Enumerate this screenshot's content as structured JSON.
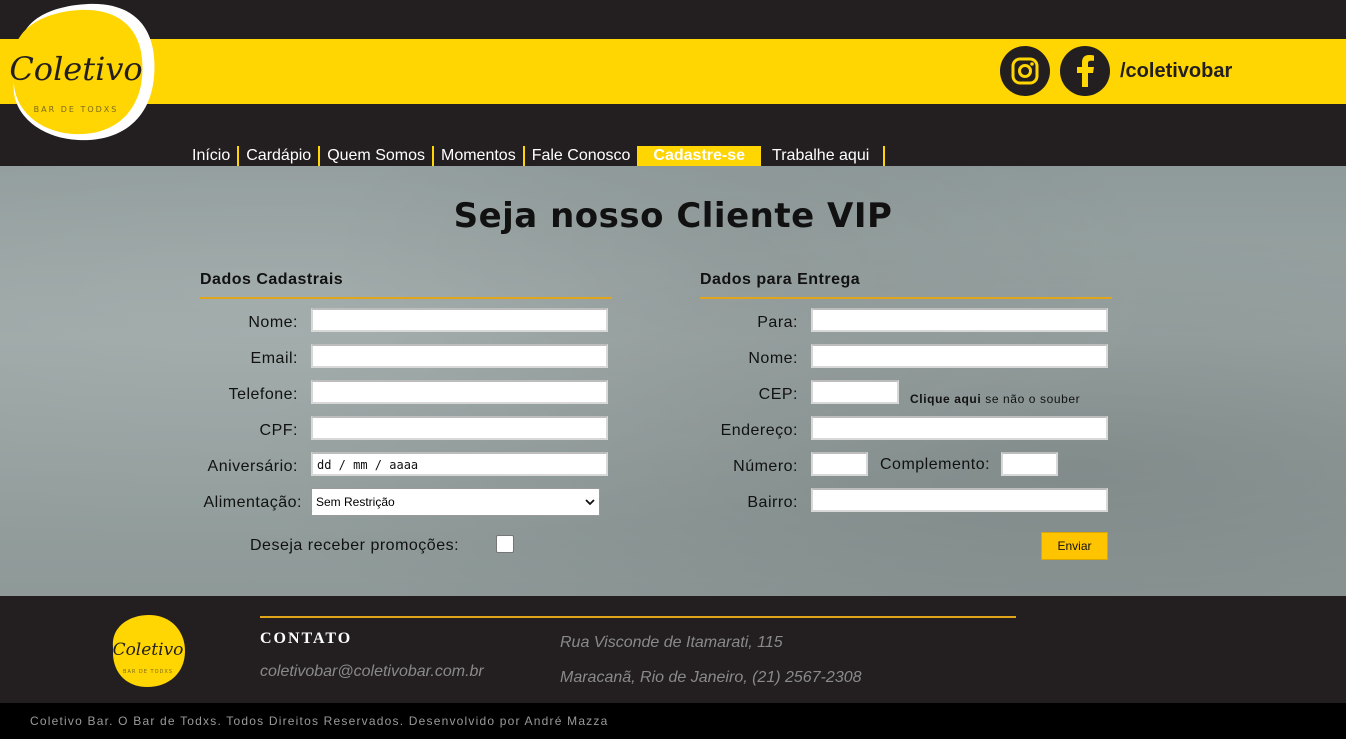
{
  "brand": {
    "logo_text": "Coletivo",
    "logo_sub": "BAR DE TODXS",
    "accent": "#ffd502",
    "dark": "#231f20"
  },
  "header": {
    "social_icons": [
      "instagram-icon",
      "facebook-icon"
    ],
    "handle": "/coletivobar"
  },
  "nav": {
    "items": [
      "Início",
      "Cardápio",
      "Quem Somos",
      "Momentos",
      "Fale Conosco",
      "Cadastre-se",
      "Trabalhe aqui"
    ],
    "active": "Cadastre-se"
  },
  "main": {
    "title": "Seja nosso Cliente VIP",
    "cadastrais": {
      "heading": "Dados Cadastrais",
      "nome_label": "Nome:",
      "email_label": "Email:",
      "telefone_label": "Telefone:",
      "cpf_label": "CPF:",
      "aniversario_label": "Aniversário:",
      "aniversario_placeholder": "dd / mm / aaaa",
      "alimentacao_label": "Alimentação:",
      "alimentacao_value": "Sem Restrição",
      "promo_label": "Deseja receber promoções:",
      "promo_checked": false
    },
    "entrega": {
      "heading": "Dados para Entrega",
      "para_label": "Para:",
      "nome_label": "Nome:",
      "cep_label": "CEP:",
      "cep_hint_link": "Clique aqui",
      "cep_hint_rest": " se não o souber",
      "endereco_label": "Endereço:",
      "numero_label": "Número:",
      "complemento_label": "Complemento:",
      "bairro_label": "Bairro:"
    },
    "submit_label": "Enviar"
  },
  "footer": {
    "contato": "CONTATO",
    "email": "coletivobar@coletivobar.com.br",
    "address_line1": "Rua Visconde de Itamarati, 115",
    "address_line2": "Maracanã, Rio de Janeiro, (21) 2567-2308",
    "copyright": "Coletivo Bar. O Bar de Todxs. Todos Direitos Reservados. Desenvolvido por André Mazza"
  }
}
